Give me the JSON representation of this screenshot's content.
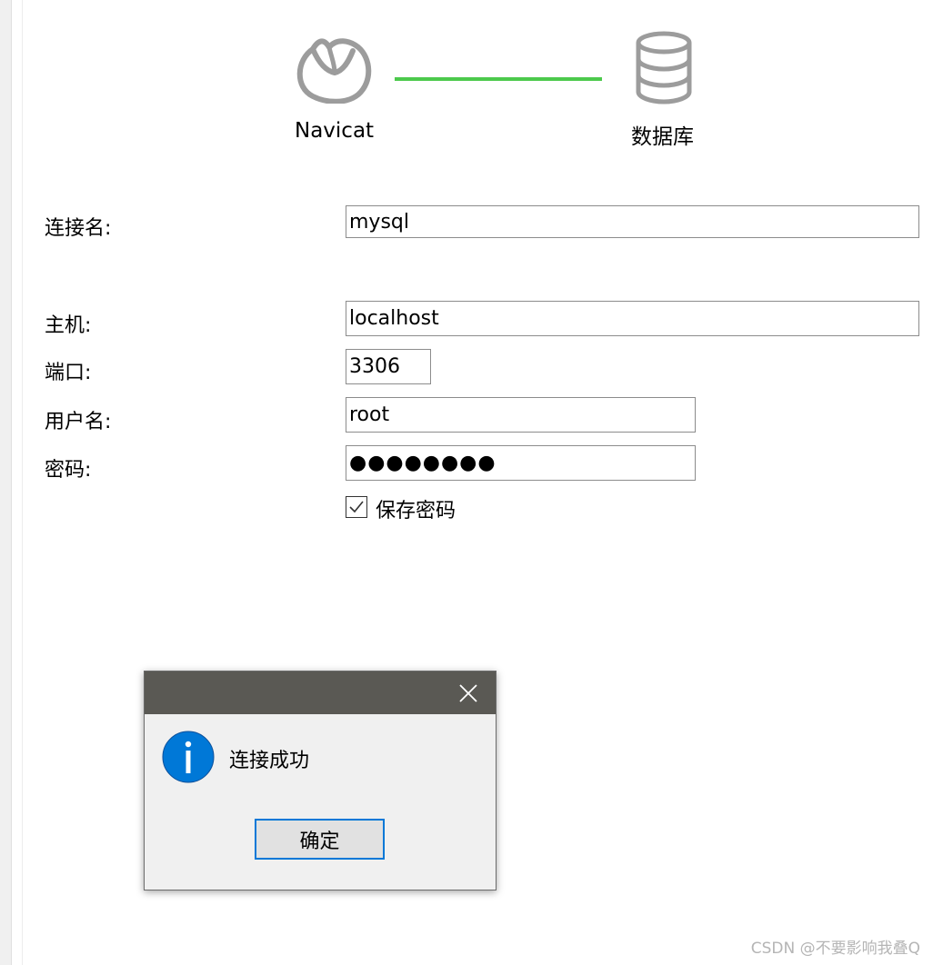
{
  "header": {
    "navicat_label": "Navicat",
    "database_label": "数据库",
    "link_color": "#4cc94c",
    "icon_color": "#9c9c9c"
  },
  "form": {
    "connection_name": {
      "label": "连接名:",
      "value": "mysql"
    },
    "host": {
      "label": "主机:",
      "value": "localhost"
    },
    "port": {
      "label": "端口:",
      "value": "3306"
    },
    "username": {
      "label": "用户名:",
      "value": "root"
    },
    "password": {
      "label": "密码:",
      "value": "●●●●●●●●"
    },
    "save_password": {
      "label": "保存密码",
      "checked": true
    }
  },
  "dialog": {
    "message": "连接成功",
    "ok_label": "确定",
    "icon": "info-icon",
    "close_icon": "close-icon",
    "titlebar_color": "#5a5954",
    "accent_color": "#0078d7"
  },
  "watermark": "CSDN @不要影响我叠Q"
}
